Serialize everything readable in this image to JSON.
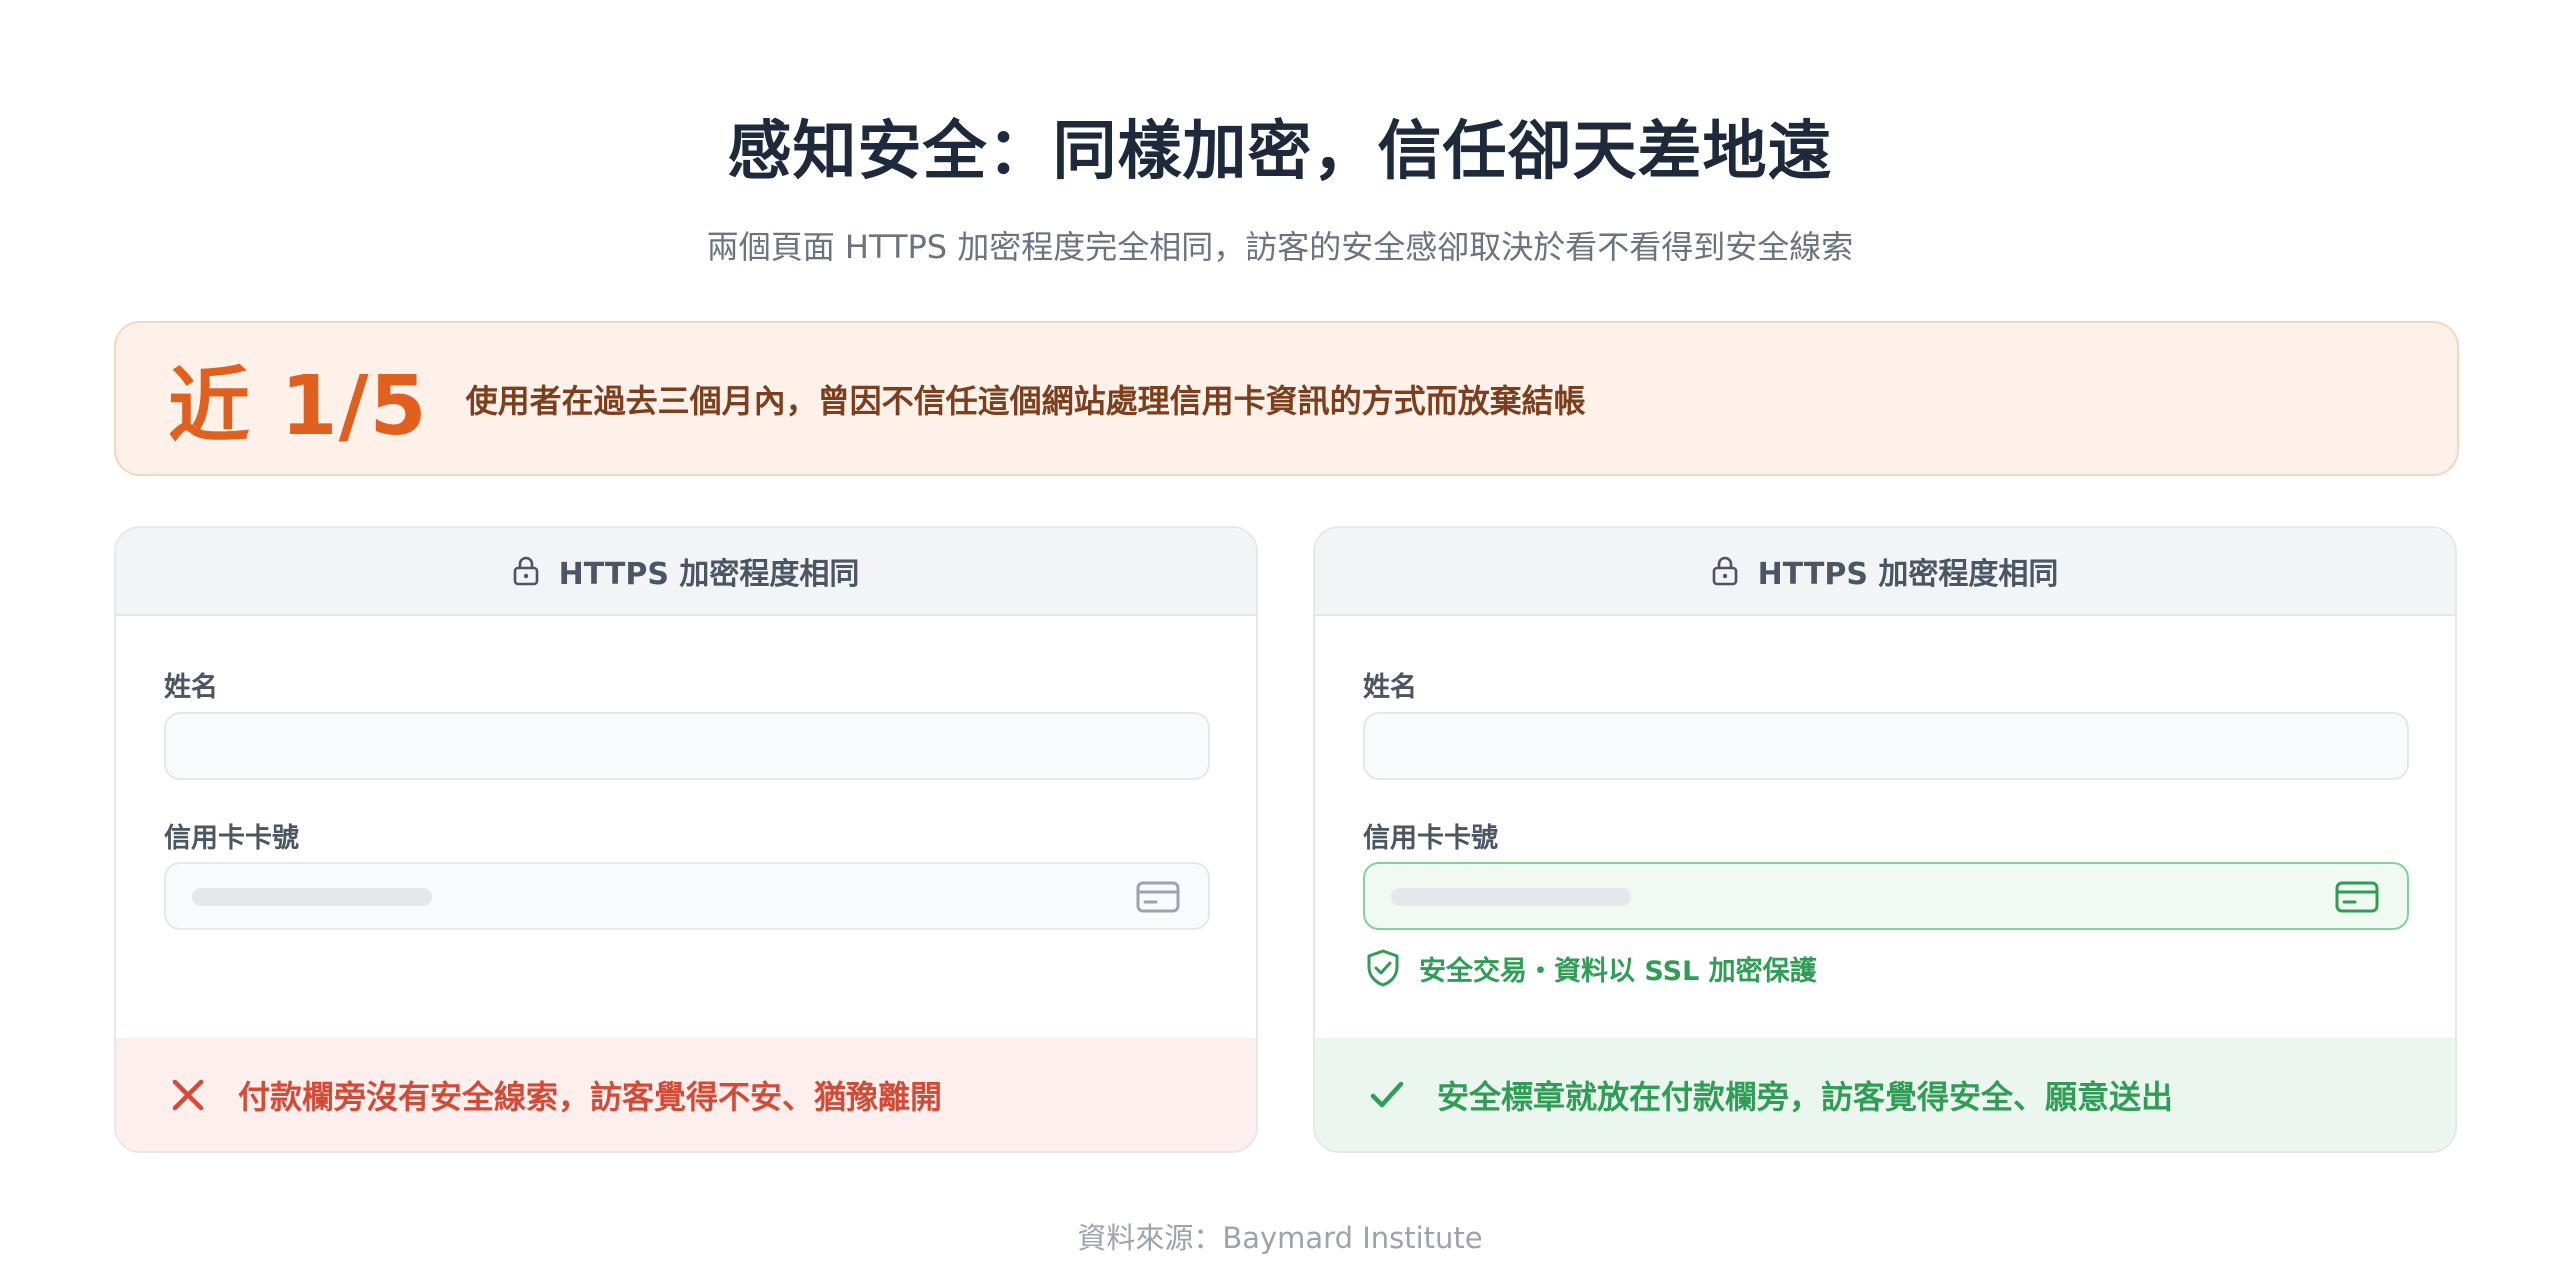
{
  "page": {
    "title": "感知安全：同樣加密，信任卻天差地遠",
    "subtitle": "兩個頁面 HTTPS 加密程度完全相同，訪客的安全感卻取決於看不看得到安全線索"
  },
  "stat": {
    "figure": "近 1/5",
    "text": "使用者在過去三個月內，曾因不信任這個網站處理信用卡資訊的方式而放棄結帳"
  },
  "cards": {
    "left": {
      "header": "HTTPS 加密程度相同",
      "name_label": "姓名",
      "card_label": "信用卡卡號",
      "footer": "付款欄旁沒有安全線索，訪客覺得不安、猶豫離開"
    },
    "right": {
      "header": "HTTPS 加密程度相同",
      "name_label": "姓名",
      "card_label": "信用卡卡號",
      "secure_note": "安全交易・資料以 SSL 加密保護",
      "footer": "安全標章就放在付款欄旁，訪客覺得安全、願意送出"
    }
  },
  "source": "資料來源：Baymard Institute",
  "colors": {
    "accent_orange": "#e0601f",
    "warning_red": "#d44a36",
    "success_green": "#2f9d55"
  },
  "icons": {
    "header": "lock-icon",
    "card_field": "credit-card-icon",
    "secure_badge": "shield-check-icon",
    "bad": "close-icon",
    "good": "checkmark-icon"
  }
}
